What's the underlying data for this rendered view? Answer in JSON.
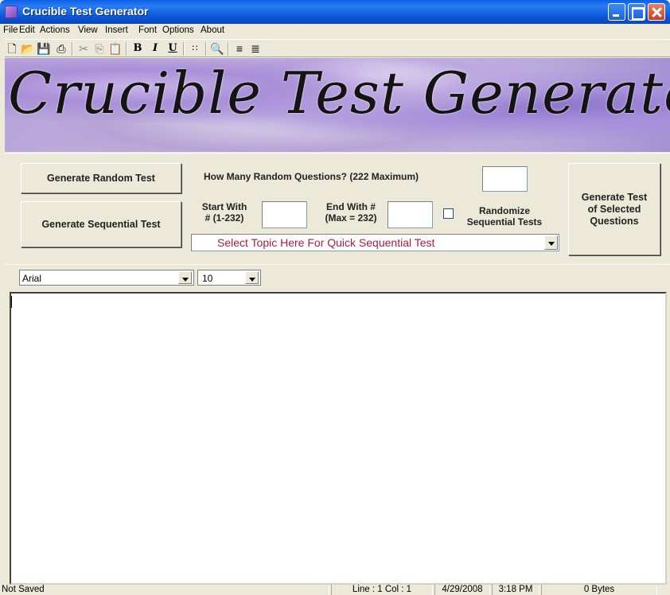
{
  "window": {
    "title": "Crucible Test Generator"
  },
  "menu": [
    "File",
    "Edit",
    "Actions",
    "View",
    "Insert",
    "Font",
    "Options",
    "About"
  ],
  "toolbar": {
    "icons": [
      "new-icon",
      "open-icon",
      "save-icon",
      "print-icon",
      "cut-icon",
      "copy-icon",
      "paste-icon",
      "bold-icon",
      "italic-icon",
      "underline-icon",
      "outline-icon",
      "find-icon",
      "align-left-icon",
      "center-icon"
    ],
    "bold": "B",
    "italic": "I",
    "underline": "U"
  },
  "banner": {
    "text": "Crucible Test Generator"
  },
  "panel": {
    "generate_random": "Generate Random Test",
    "generate_sequential": "Generate Sequential Test",
    "how_many": "How Many Random Questions? (222 Maximum)",
    "start_with": "Start With\n# (1-232)",
    "end_with": "End With #\n(Max = 232)",
    "randomize": "Randomize\nSequential Tests",
    "topic": "Select Topic Here For Quick Sequential Test",
    "generate_selected": "Generate Test\nof Selected\nQuestions",
    "how_many_value": "",
    "start_value": "",
    "end_value": "",
    "randomize_checked": false
  },
  "font": {
    "name": "Arial",
    "size": "10"
  },
  "editor": {
    "content": ""
  },
  "status": {
    "saved": "Not Saved",
    "position": "Line : 1   Col : 1",
    "date": "4/29/2008",
    "time": "3:18 PM",
    "size": "0 Bytes"
  }
}
